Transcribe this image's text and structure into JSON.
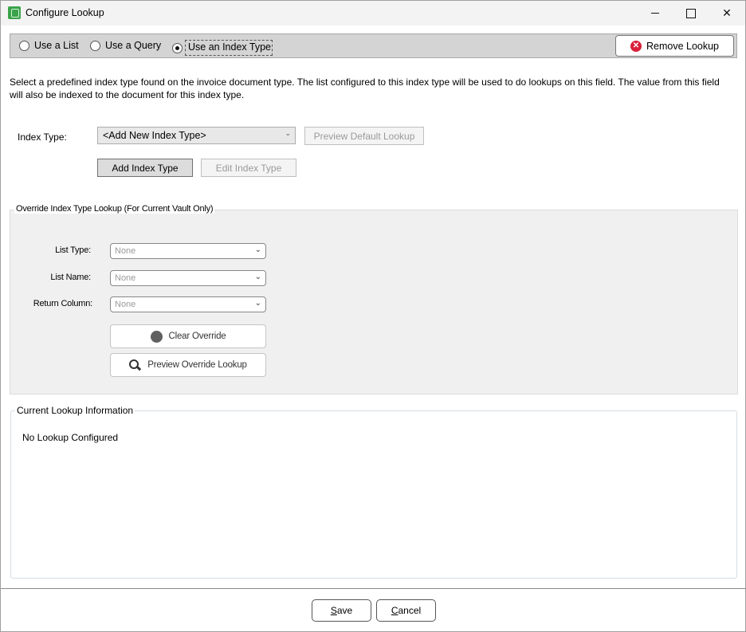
{
  "window": {
    "title": "Configure Lookup",
    "app_icon": "vault-app-icon",
    "controls": {
      "minimize": "minimize-icon",
      "maximize": "maximize-icon",
      "close": "close-icon"
    }
  },
  "mode": {
    "options": [
      {
        "label": "Use a List",
        "selected": false
      },
      {
        "label": "Use a Query",
        "selected": false
      },
      {
        "label": "Use an Index Type",
        "selected": true
      }
    ],
    "remove_button": "Remove Lookup"
  },
  "description": "Select a predefined index type found on the invoice document type. The list configured to this index type will be used to do lookups on this field. The value from this field will also be indexed to the document for this index type.",
  "index_type": {
    "label": "Index Type:",
    "selected": "<Add New Index Type>",
    "preview_default_button": "Preview Default Lookup",
    "add_button": "Add Index Type",
    "edit_button": "Edit Index Type"
  },
  "override": {
    "legend": "Override Index Type Lookup (For Current Vault Only)",
    "list_type": {
      "label": "List Type:",
      "value": "None"
    },
    "list_name": {
      "label": "List Name:",
      "value": "None"
    },
    "return_column": {
      "label": "Return Column:",
      "value": "None"
    },
    "clear_button": "Clear Override",
    "preview_button": "Preview Override Lookup"
  },
  "current_info": {
    "legend": "Current Lookup Information",
    "text": "No Lookup Configured"
  },
  "footer": {
    "save": {
      "mnemonic": "S",
      "rest": "ave"
    },
    "cancel": {
      "mnemonic": "C",
      "rest": "ancel"
    }
  },
  "colors": {
    "remove_icon": "#d9213a",
    "app_icon": "#3aa34a",
    "mode_bar": "#d4d4d4",
    "override_bg": "#f0f0f0"
  }
}
